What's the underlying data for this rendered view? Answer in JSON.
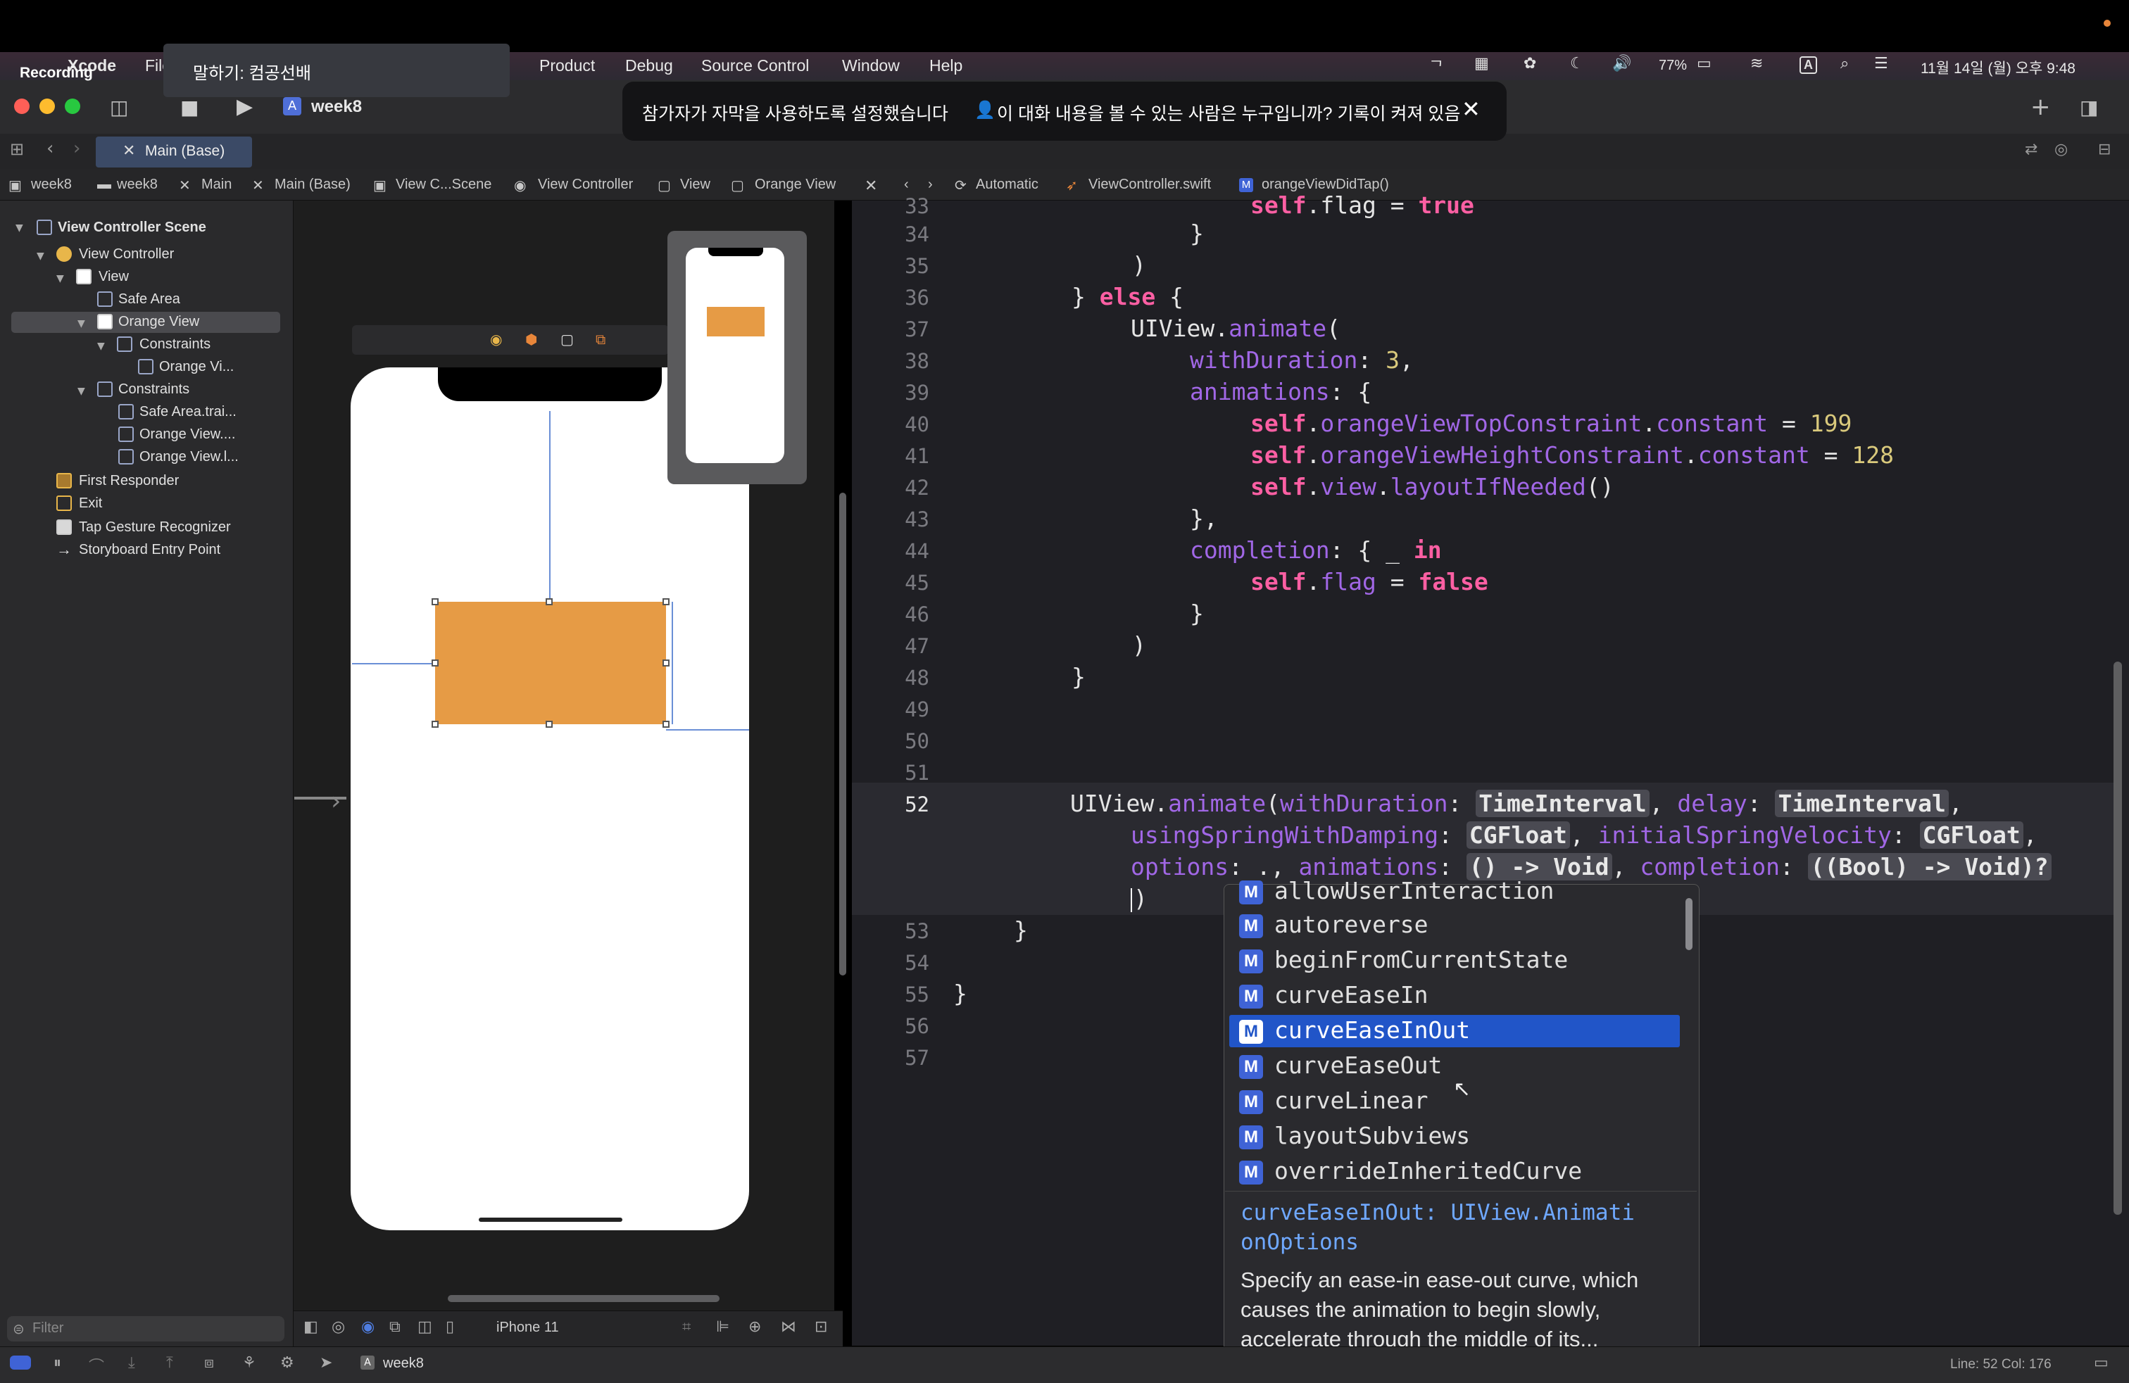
{
  "overlay": {
    "recording_label": "Recording",
    "speaking": "말하기: 컴공선배",
    "caption_notice": "참가자가 자막을 사용하도록 설정했습니다",
    "caption_question": "이 대화 내용을 볼 수 있는 사람은 누구입니까? 기록이 켜져 있음"
  },
  "menubar": {
    "app": "Xcode",
    "file": "File",
    "product": "Product",
    "debug": "Debug",
    "source_control": "Source Control",
    "window": "Window",
    "help": "Help",
    "battery": "77%",
    "datetime": "11월 14일 (월) 오후 9:48"
  },
  "toolbar": {
    "scheme": "week8"
  },
  "tab": {
    "label": "Main (Base)"
  },
  "jumpbar_left": [
    "week8",
    "week8",
    "Main",
    "Main (Base)",
    "View C...Scene",
    "View Controller",
    "View",
    "Orange View"
  ],
  "jumpbar_right": [
    "Automatic",
    "ViewController.swift",
    "orangeViewDidTap()"
  ],
  "navigator": {
    "items": [
      "View Controller Scene",
      "View Controller",
      "View",
      "Safe Area",
      "Orange View",
      "Constraints",
      "Orange Vi...",
      "Constraints",
      "Safe Area.trai...",
      "Orange View....",
      "Orange View.l...",
      "First Responder",
      "Exit",
      "Tap Gesture Recognizer",
      "Storyboard Entry Point"
    ],
    "filter_placeholder": "Filter"
  },
  "canvas": {
    "device": "iPhone 11"
  },
  "editor": {
    "line_numbers": [
      "33",
      "34",
      "35",
      "36",
      "37",
      "38",
      "39",
      "40",
      "41",
      "42",
      "43",
      "44",
      "45",
      "46",
      "47",
      "48",
      "49",
      "50",
      "51",
      "52",
      "53",
      "54",
      "55",
      "56",
      "57"
    ],
    "code": {
      "l33a": "self",
      "l33b": ".flag = ",
      "l33c": "true",
      "l34": "}",
      "l35": ")",
      "l36a": "} ",
      "l36b": "else",
      "l36c": " {",
      "l37a": "UIView.",
      "l37b": "animate",
      "l37c": "(",
      "l38a": "withDuration",
      "l38b": ": ",
      "l38c": "3",
      "l38d": ",",
      "l39a": "animations",
      "l39b": ": {",
      "l40a": "self",
      "l40b": ".",
      "l40c": "orangeViewTopConstraint",
      "l40d": ".",
      "l40e": "constant",
      "l40f": " = ",
      "l40g": "199",
      "l41a": "self",
      "l41b": ".",
      "l41c": "orangeViewHeightConstraint",
      "l41d": ".",
      "l41e": "constant",
      "l41f": " = ",
      "l41g": "128",
      "l42a": "self",
      "l42b": ".",
      "l42c": "view",
      "l42d": ".",
      "l42e": "layoutIfNeeded",
      "l42f": "()",
      "l43": "},",
      "l44a": "completion",
      "l44b": ": { _ ",
      "l44c": "in",
      "l45a": "self",
      "l45b": ".",
      "l45c": "flag",
      "l45d": " = ",
      "l45e": "false",
      "l46": "}",
      "l47": ")",
      "l48": "}",
      "l52a": "UIView.",
      "l52b": "animate",
      "l52c": "(",
      "l52d": "withDuration",
      "l52e": ": ",
      "l52f": "TimeInterval",
      "l52g": ", ",
      "l52h": "delay",
      "l52i": ": ",
      "l52j": "TimeInterval",
      "l52k": ",",
      "l52l": "usingSpringWithDamping",
      "l52m": ": ",
      "l52n": "CGFloat",
      "l52o": ", ",
      "l52p": "initialSpringVelocity",
      "l52q": ": ",
      "l52r": "CGFloat",
      "l52s": ",",
      "l52t": "options",
      "l52u": ": .",
      "l52v": ", ",
      "l52w": "animations",
      "l52x": ": ",
      "l52y": "() -> Void",
      "l52z": ", ",
      "l52aa": "completion",
      "l52ab": ": ",
      "l52ac": "((Bool) -> Void)?",
      "l52ad": ")",
      "l53": "}",
      "l55": "}"
    }
  },
  "autocomplete": {
    "badge": "M",
    "items": [
      "allowUserInteraction",
      "autoreverse",
      "beginFromCurrentState",
      "curveEaseIn",
      "curveEaseInOut",
      "curveEaseOut",
      "curveLinear",
      "layoutSubviews",
      "overrideInheritedCurve"
    ],
    "selected": "curveEaseInOut",
    "doc_name": "curveEaseInOut",
    "doc_type_1": ": UIView.Animati",
    "doc_type_2": "onOptions",
    "doc_desc_1": "Specify an ease-in ease-out curve, which",
    "doc_desc_2": "causes the animation to begin slowly,",
    "doc_desc_3": "accelerate through the middle of its..."
  },
  "statusbar": {
    "scheme": "week8",
    "position": "Line: 52  Col: 176"
  },
  "colors": {
    "accent": "#2155c8",
    "orange_view": "#e69b45",
    "keyword": "#fc5fa3",
    "number": "#d9c97c"
  }
}
